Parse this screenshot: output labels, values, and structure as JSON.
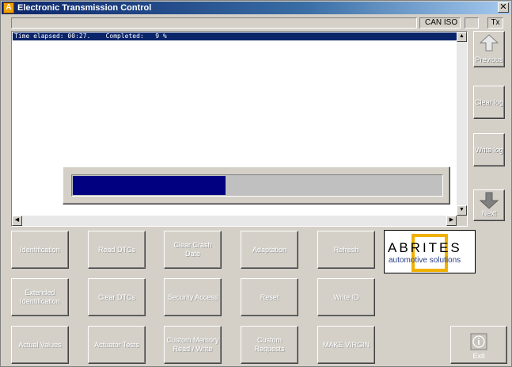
{
  "window": {
    "title": "Electronic Transmission Control",
    "app_icon": "A",
    "close_label": "✕"
  },
  "status": {
    "protocol": "CAN ISO",
    "tx": "Tx"
  },
  "log": {
    "line": "Time elapsed: 00:27.    Completed:   9 %"
  },
  "progress": {
    "completed_fraction": 0.09
  },
  "side_buttons": {
    "previous": "Previous",
    "clear_log": "Clear log",
    "write_log": "Write log",
    "next": "Next"
  },
  "functions": {
    "identification": "Identification",
    "read_dtcs": "Read DTCs",
    "clear_crash_date": "Clear Crash Date",
    "adaptation": "Adaptation",
    "refresh": "Refresh",
    "extended_identification": "Extended Identification",
    "clear_dtcs": "Clear DTCs",
    "security_access": "Security Access",
    "reset": "Reset",
    "write_id": "Write ID",
    "actual_values": "Actual Values",
    "actuator_tests": "Actuator Tests",
    "custom_memory": "Custom Memory Read / Write",
    "custom_requests": "Custom Requests",
    "make_virgin": "MAKE VIRGIN"
  },
  "logo": {
    "word": "ABRITES",
    "tagline": "automotive solutions"
  },
  "exit": {
    "label": "Exit"
  },
  "colors": {
    "titlebar": "#0a246a",
    "progress": "#000080",
    "logo_accent": "#f0b000"
  }
}
